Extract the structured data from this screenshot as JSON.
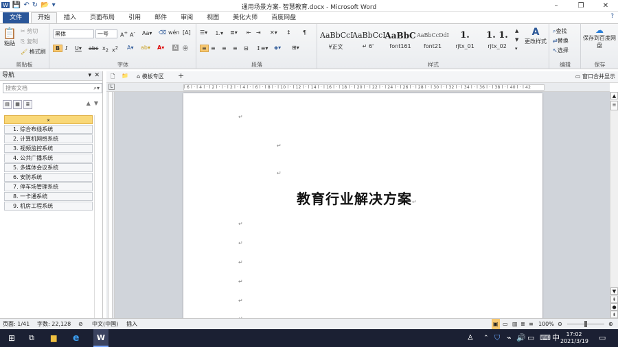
{
  "window": {
    "title": "通用场景方案- 智慧教育.docx - Microsoft Word",
    "minimize_glyph": "–",
    "maximize_glyph": "❐",
    "close_glyph": "✕"
  },
  "qat": {
    "icons": [
      "word-icon",
      "save-icon",
      "undo-icon",
      "redo-icon",
      "open-icon"
    ]
  },
  "tabs": [
    "文件",
    "开始",
    "插入",
    "页面布局",
    "引用",
    "邮件",
    "审阅",
    "视图",
    "美化大师",
    "百度网盘"
  ],
  "active_tab": "开始",
  "ribbon": {
    "clipboard": {
      "label": "剪贴板",
      "paste": "粘贴",
      "cut": "剪切",
      "copy": "复制",
      "format_painter": "格式刷"
    },
    "font": {
      "label": "字体",
      "font_name": "黑体",
      "font_size": "一号"
    },
    "paragraph": {
      "label": "段落"
    },
    "styles": {
      "label": "样式",
      "items": [
        {
          "sample": "AaBbCcI",
          "name": "¥正文"
        },
        {
          "sample": "AaBbCcI",
          "name": "↵ 6'"
        },
        {
          "sample": "AaBbC",
          "name": "font161"
        },
        {
          "sample": "AaBbCcDdI",
          "name": "font21"
        },
        {
          "sample": "1.",
          "name": "rjtx_01"
        },
        {
          "sample": "1. 1.",
          "name": "rjtx_02"
        }
      ],
      "change_styles": "更改样式"
    },
    "editing": {
      "label": "编辑",
      "find": "查找",
      "replace": "替换",
      "select": "选择"
    },
    "save": {
      "label": "保存",
      "button": "保存到百度网盘"
    }
  },
  "nav": {
    "title": "导航",
    "search_placeholder": "搜索文档",
    "headings": [
      "1. 综合布线系统",
      "2. 计算机网络系统",
      "3. 视频监控系统",
      "4. 公共广播系统",
      "5. 多媒体会议系统",
      "6. 安防系统",
      "7. 停车场管理系统",
      "8. 一卡通系统",
      "9. 机房工程系统"
    ]
  },
  "doctabs": {
    "template_zone": "模板专区",
    "window_toggle": "窗口合并显示",
    "add": "+"
  },
  "ruler": "l 6 l · l 4 l · l 2 l · l · l 2 l · l 4 l · l 6 l · l 8 l · l 10 l · l 12 l · l 14 l · l 16 l · l 18 l · l 20 l · l 22 l · l 24 l · l 26 l · l 28 l · l 30 l · l 32 l · l 34 l · l 36 l · l 38 l · l 40 l · l 42",
  "document": {
    "title": "教育行业解决方案",
    "para_mark": "↵"
  },
  "status": {
    "page": "页面: 1/41",
    "words": "字数: 22,128",
    "language": "中文(中国)",
    "insert_mode": "插入",
    "zoom": "100%"
  },
  "taskbar": {
    "time": "17:02",
    "date": "2021/3/19",
    "ime": "中"
  }
}
